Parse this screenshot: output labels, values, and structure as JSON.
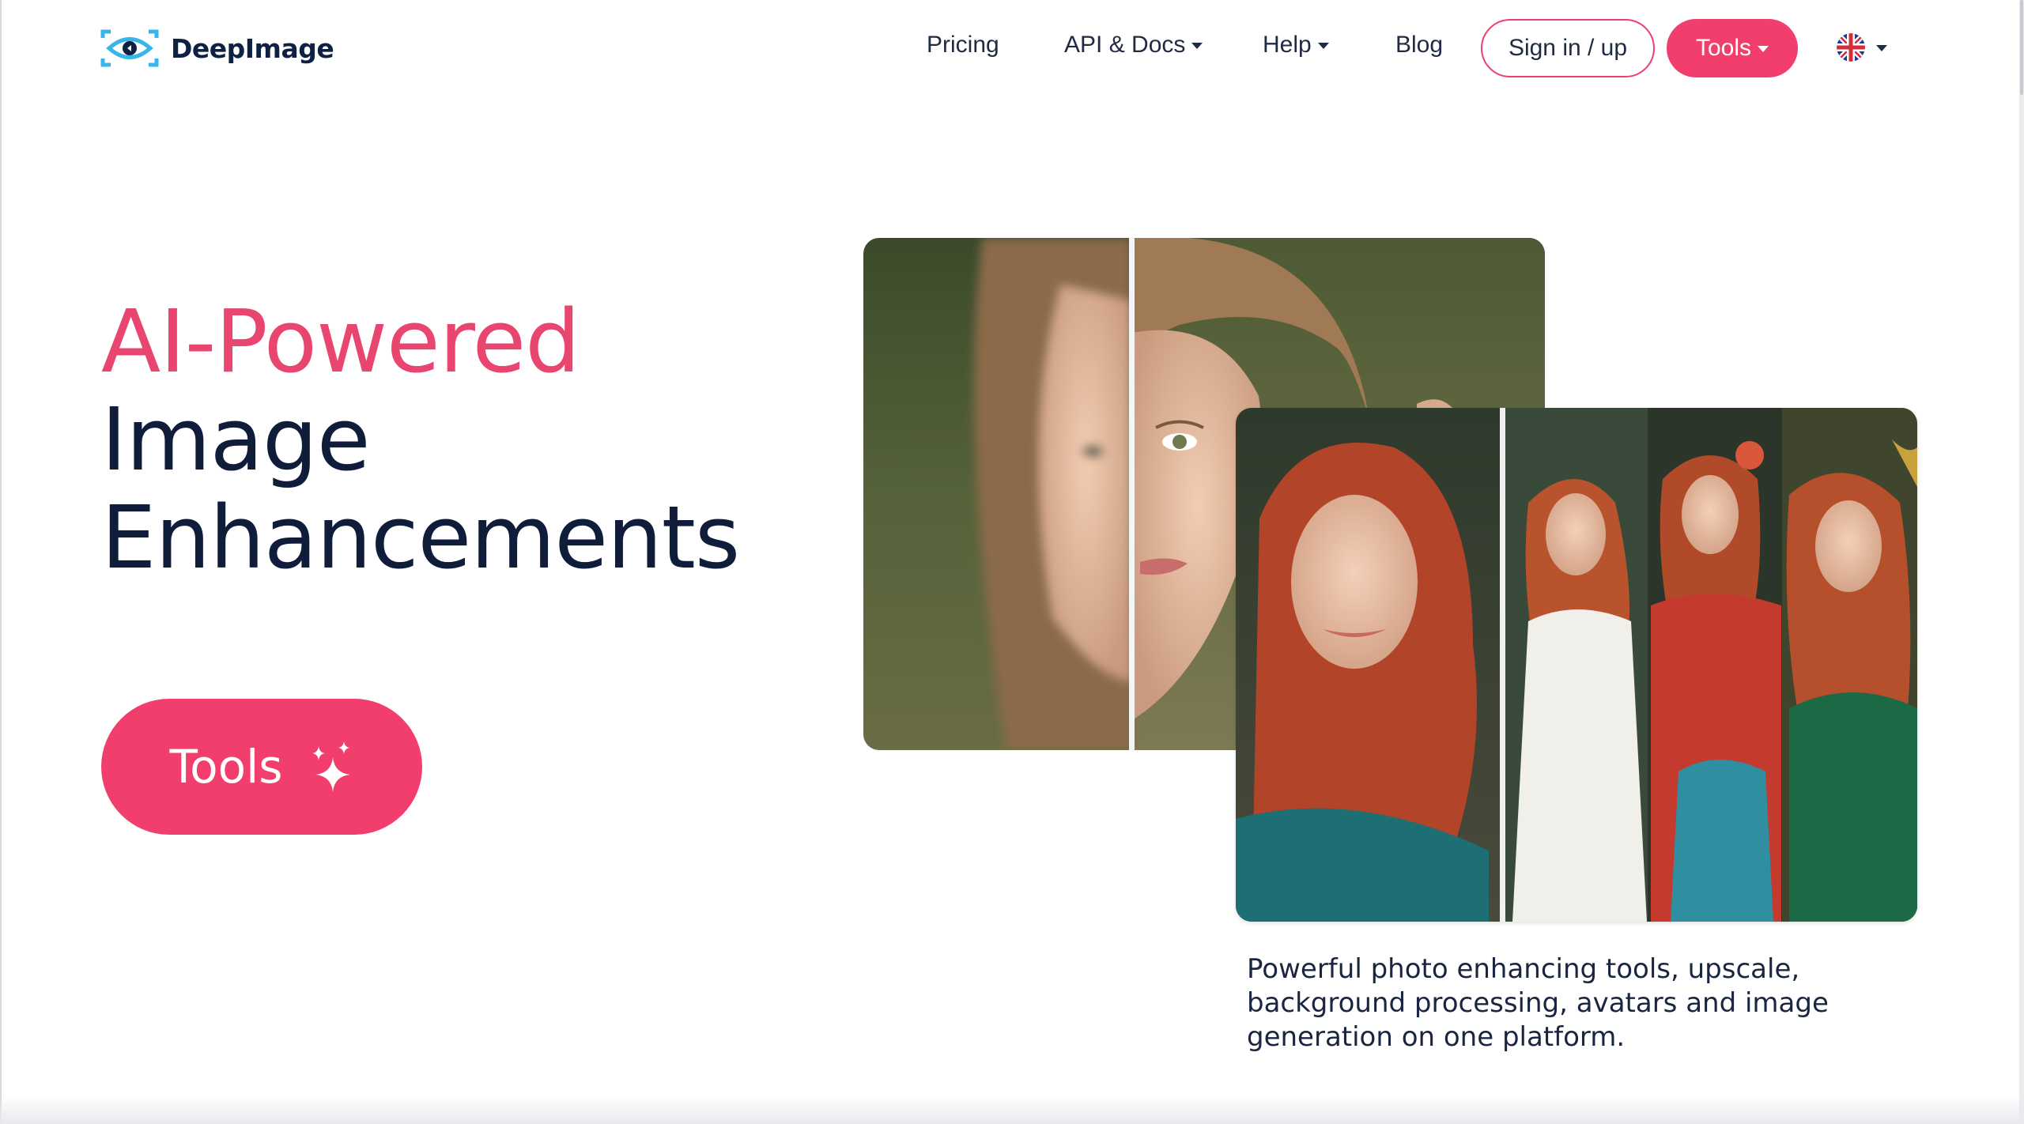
{
  "brand": {
    "name": "DeepImage",
    "logo_icon": "eye-icon",
    "accent_color": "#f23e6c",
    "text_color": "#0f1d3b"
  },
  "nav": {
    "pricing": "Pricing",
    "api_docs": "API & Docs",
    "help": "Help",
    "blog": "Blog",
    "signin": "Sign in / up",
    "tools": "Tools",
    "language_icon": "uk-flag-icon"
  },
  "hero": {
    "title_line1": "AI-Powered",
    "title_line2": "Image",
    "title_line3": "Enhancements",
    "cta_label": "Tools",
    "cta_icon": "sparkle-icon",
    "description": "Powerful photo enhancing tools, upscale, background processing, avatars and image generation on one platform."
  }
}
